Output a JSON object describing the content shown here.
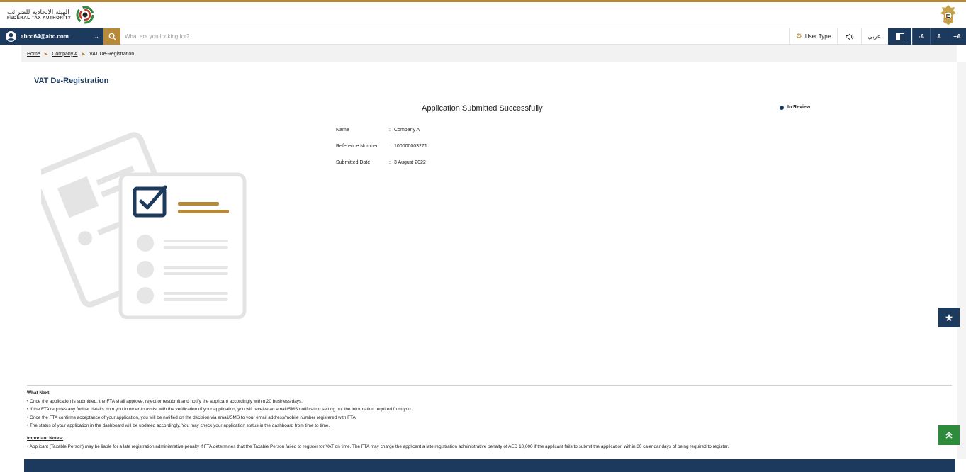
{
  "header": {
    "logo_arabic": "الهيئة الاتحادية للضرائب",
    "logo_english": "FEDERAL TAX AUTHORITY"
  },
  "navbar": {
    "user_email": "abcd64@abc.com",
    "search_placeholder": "What are you looking for?",
    "user_type_label": "User Type",
    "arabic_label": "عربي",
    "font_decrease_label": "-A",
    "font_reset_label": "A",
    "font_increase_label": "+A"
  },
  "breadcrumb": {
    "items": [
      "Home",
      "Company A"
    ],
    "current": "VAT De-Registration"
  },
  "page": {
    "title": "VAT De-Registration",
    "success_message": "Application Submitted Successfully",
    "status": "In Review",
    "details": [
      {
        "label": "Name",
        "value": "Company A"
      },
      {
        "label": "Reference Number",
        "value": "100000003271"
      },
      {
        "label": "Submitted Date",
        "value": "3 August 2022"
      }
    ]
  },
  "notes": {
    "what_next_heading": "What Next:",
    "what_next": [
      "• Once the application is submitted, the FTA shall approve, reject or resubmit and notify the applicant accordingly within 20 business days.",
      "• If the FTA requires any further details from you in order to assist with the verification of your application, you will receive an email/SMS notification setting out the information required from you.",
      "• Once the FTA confirms acceptance of your application, you will be notified on the decision via email/SMS to your email address/mobile number registered with FTA.",
      "• The status of your application in the dashboard will be updated accordingly. You may check your application status in the dashboard from time to time."
    ],
    "important_heading": "Important Notes:",
    "important": [
      "• Applicant (Taxable Person) may be liable for a late registration administrative penalty if FTA determines that the Taxable Person failed to register for VAT on time. The FTA may charge the applicant a late registration administrative penalty of AED 10,000 if the applicant fails to submit the application within 30 calendar days of being required to register."
    ]
  },
  "colors": {
    "navy": "#1c3a5e",
    "gold": "#b68a3a",
    "green": "#2e8b3b"
  },
  "icons": {
    "search": "search-icon",
    "user": "user-avatar-icon",
    "favorite": "star-icon",
    "scroll_top": "double-chevron-up-icon"
  }
}
